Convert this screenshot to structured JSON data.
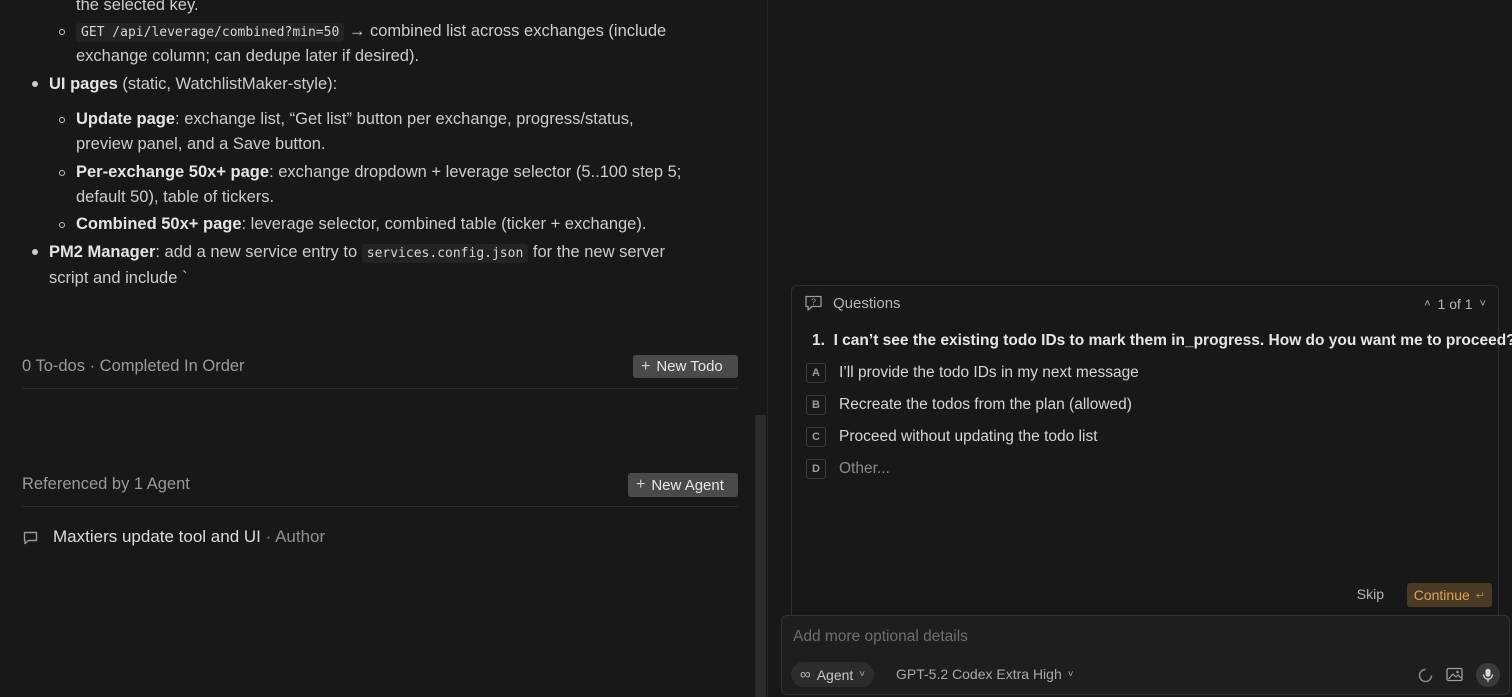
{
  "plan": {
    "line_selected_key": "the selected key.",
    "combined_endpoint_code": "GET /api/leverage/combined?min=50",
    "combined_endpoint_text": "→ combined list across exchanges (include",
    "combined_endpoint_text2": "exchange column; can dedupe later if desired).",
    "ui_pages_bold": "UI pages",
    "ui_pages_rest": " (static, WatchlistMaker-style):",
    "update_page_bold": "Update page",
    "update_page_rest": ": exchange list, “Get list” button per exchange, progress/status,",
    "update_page_rest2": "preview panel, and a Save button.",
    "per_exchange_bold": "Per-exchange 50x+ page",
    "per_exchange_rest": ": exchange dropdown + leverage selector (5..100 step 5;",
    "per_exchange_rest2": "default 50), table of tickers.",
    "combined_page_bold": "Combined 50x+ page",
    "combined_page_rest": ": leverage selector, combined table (ticker + exchange).",
    "pm2_bold": "PM2 Manager",
    "pm2_rest": ": add a new service entry to",
    "pm2_code": "services.config.json",
    "pm2_rest2": "for the new server",
    "pm2_rest3": "script and include `"
  },
  "todos": {
    "summary": "0 To-dos · Completed In Order",
    "new_button": "New Todo"
  },
  "agents": {
    "summary": "Referenced by 1 Agent",
    "new_button": "New Agent",
    "items": [
      {
        "title": "Maxtiers update tool and UI",
        "suffix": "· Author"
      }
    ]
  },
  "questions": {
    "header": "Questions",
    "pager": "1 of 1",
    "number": "1.",
    "question": "I can’t see the existing todo IDs to mark them in_progress. How do you want me to proceed?",
    "options": [
      {
        "key": "A",
        "text": "I’ll provide the todo IDs in my next message"
      },
      {
        "key": "B",
        "text": "Recreate the todos from the plan (allowed)"
      },
      {
        "key": "C",
        "text": "Proceed without updating the todo list"
      },
      {
        "key": "D",
        "text": "Other..."
      }
    ],
    "skip": "Skip",
    "continue": "Continue"
  },
  "composer": {
    "placeholder": "Add more optional details",
    "mode": "Agent",
    "model": "GPT-5.2 Codex Extra High"
  },
  "colors": {
    "background": "#181818",
    "continue_bg": "#4a3a24",
    "continue_text": "#d9a25a"
  }
}
